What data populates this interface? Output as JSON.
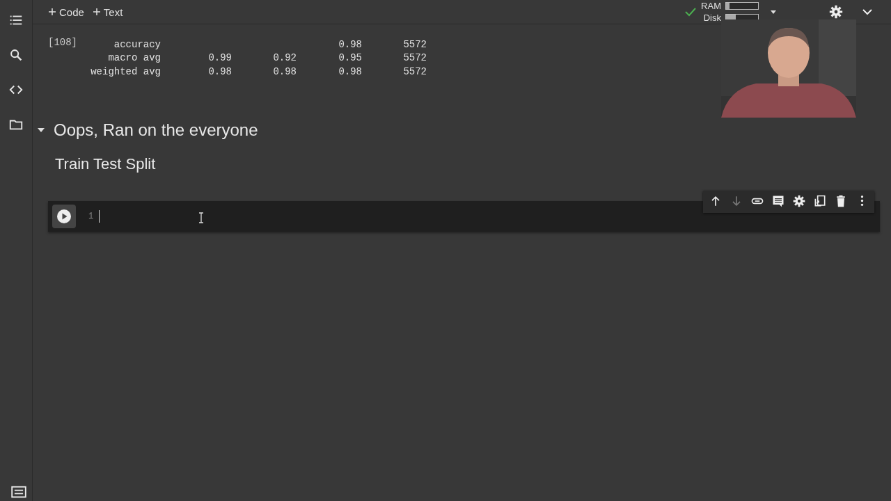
{
  "toolbar": {
    "add_buttons": [
      {
        "label": "Code"
      },
      {
        "label": "Text"
      }
    ],
    "resources": {
      "connected": true,
      "meters": [
        {
          "label": "RAM",
          "level": 0.1
        },
        {
          "label": "Disk",
          "level": 0.3
        }
      ]
    }
  },
  "sidebar": {
    "items": [
      {
        "kind": "toc"
      },
      {
        "kind": "search"
      },
      {
        "kind": "code"
      },
      {
        "kind": "files"
      }
    ]
  },
  "output": {
    "execution_count": "[108]",
    "rows": [
      {
        "label": "accuracy",
        "f1_score": "0.98",
        "support": "5572"
      },
      {
        "label": "macro avg",
        "precision": "0.99",
        "recall": "0.92",
        "f1_score": "0.95",
        "support": "5572"
      },
      {
        "label": "weighted avg",
        "precision": "0.98",
        "recall": "0.98",
        "f1_score": "0.98",
        "support": "5572"
      }
    ]
  },
  "section": {
    "heading": "Oops, Ran on the everyone",
    "expanded": true,
    "subheading": "Train Test Split"
  },
  "code_cell": {
    "line_number": "1",
    "toolbar": [
      {
        "kind": "up",
        "disabled": false
      },
      {
        "kind": "down",
        "disabled": true
      },
      {
        "kind": "link",
        "disabled": false
      },
      {
        "kind": "comment",
        "disabled": false
      },
      {
        "kind": "settings",
        "disabled": false
      },
      {
        "kind": "mirror",
        "disabled": false
      },
      {
        "kind": "delete",
        "disabled": false
      },
      {
        "kind": "more",
        "disabled": false
      }
    ]
  }
}
